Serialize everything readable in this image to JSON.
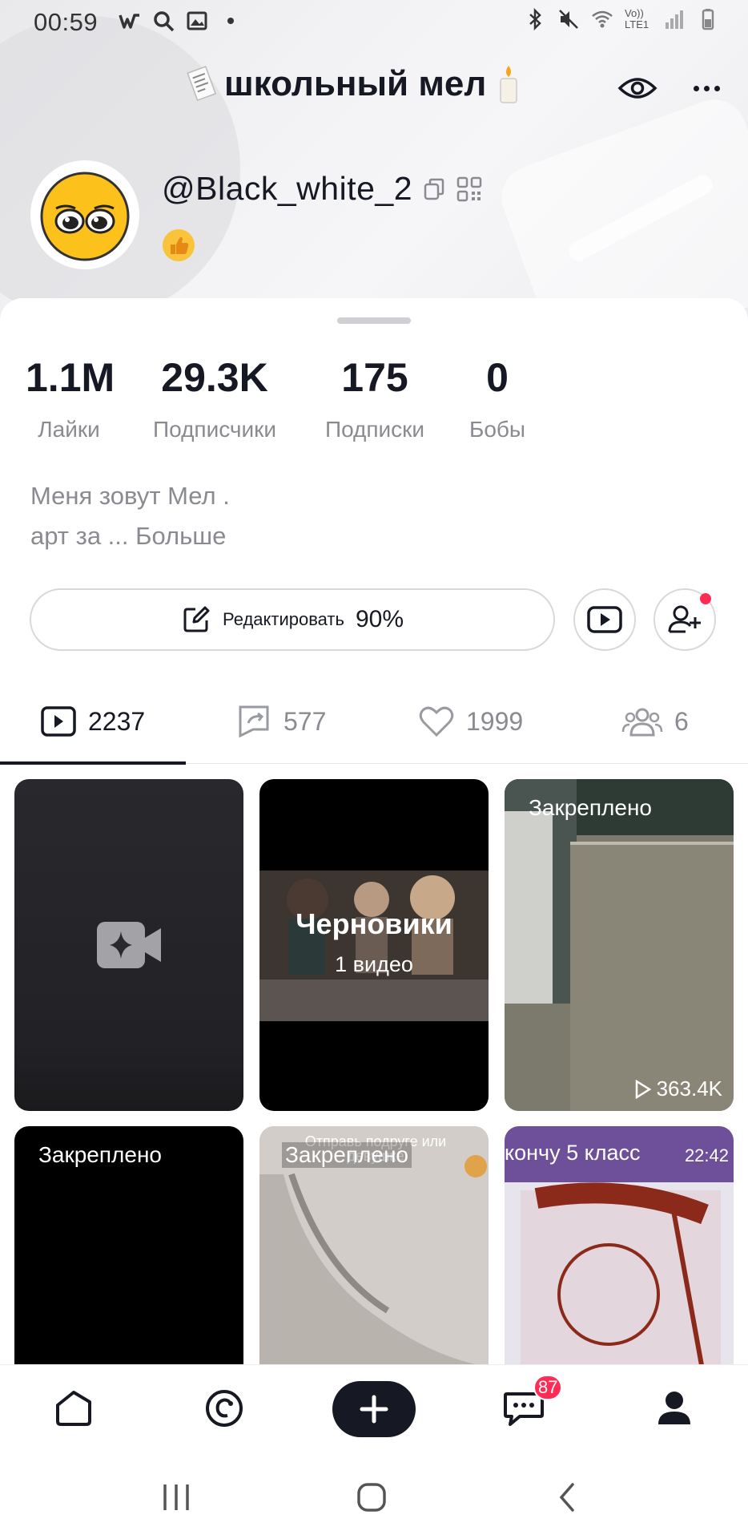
{
  "status_bar": {
    "time": "00:59",
    "left_icons": [
      "w-app-icon",
      "search-icon",
      "gallery-icon",
      "dot-icon"
    ],
    "right_icons": [
      "bluetooth-icon",
      "mute-icon",
      "wifi-icon",
      "volte-icon",
      "signal-icon",
      "battery-icon"
    ],
    "network_label": "Vo)) LTE1"
  },
  "header": {
    "title": "школьный мел",
    "title_emoji_left": "receipt-emoji",
    "title_emoji_right": "candle-emoji",
    "eye_icon": "eye-icon",
    "more_icon": "more-dots-icon"
  },
  "profile": {
    "username": "@Black_white_2",
    "status_emoji": "thumbs-up-emoji",
    "avatar": "yellow-emoji-avatar"
  },
  "stats": [
    {
      "value": "1.1M",
      "label": "Лайки"
    },
    {
      "value": "29.3K",
      "label": "Подписчики"
    },
    {
      "value": "175",
      "label": "Подписки"
    },
    {
      "value": "0",
      "label": "Бобы"
    }
  ],
  "bio": {
    "line1": "Меня зовут Мел .",
    "line2_text": "арт за ... ",
    "more_label": "Больше"
  },
  "actions": {
    "edit_label": "Редактировать",
    "edit_progress": "90%",
    "youtube_icon": "youtube-icon",
    "add_friend_icon": "add-friend-icon"
  },
  "tabs": [
    {
      "icon": "video-icon",
      "count": "2237"
    },
    {
      "icon": "repost-icon",
      "count": "577"
    },
    {
      "icon": "heart-icon",
      "count": "1999"
    },
    {
      "icon": "group-icon",
      "count": "6"
    }
  ],
  "grid": {
    "drafts_title": "Черновики",
    "drafts_count": "1 видео",
    "pinned_label": "Закреплено",
    "views_1": "363.4K",
    "cell5_caption": "Отправь подруге или девушке",
    "cell6_caption": "кончу 5 класс",
    "cell6_time": "22:42",
    "new_video_icon": "camera-sparkle-icon"
  },
  "bottom_nav": {
    "items": [
      "home-icon",
      "friends-icon",
      "create-icon",
      "inbox-icon",
      "profile-icon"
    ],
    "inbox_badge": "87"
  },
  "system_nav": [
    "recents-icon",
    "home-circle-icon",
    "back-icon"
  ],
  "colors": {
    "accent": "#fe2c55",
    "text": "#161823",
    "secondary": "#8a8b91"
  }
}
